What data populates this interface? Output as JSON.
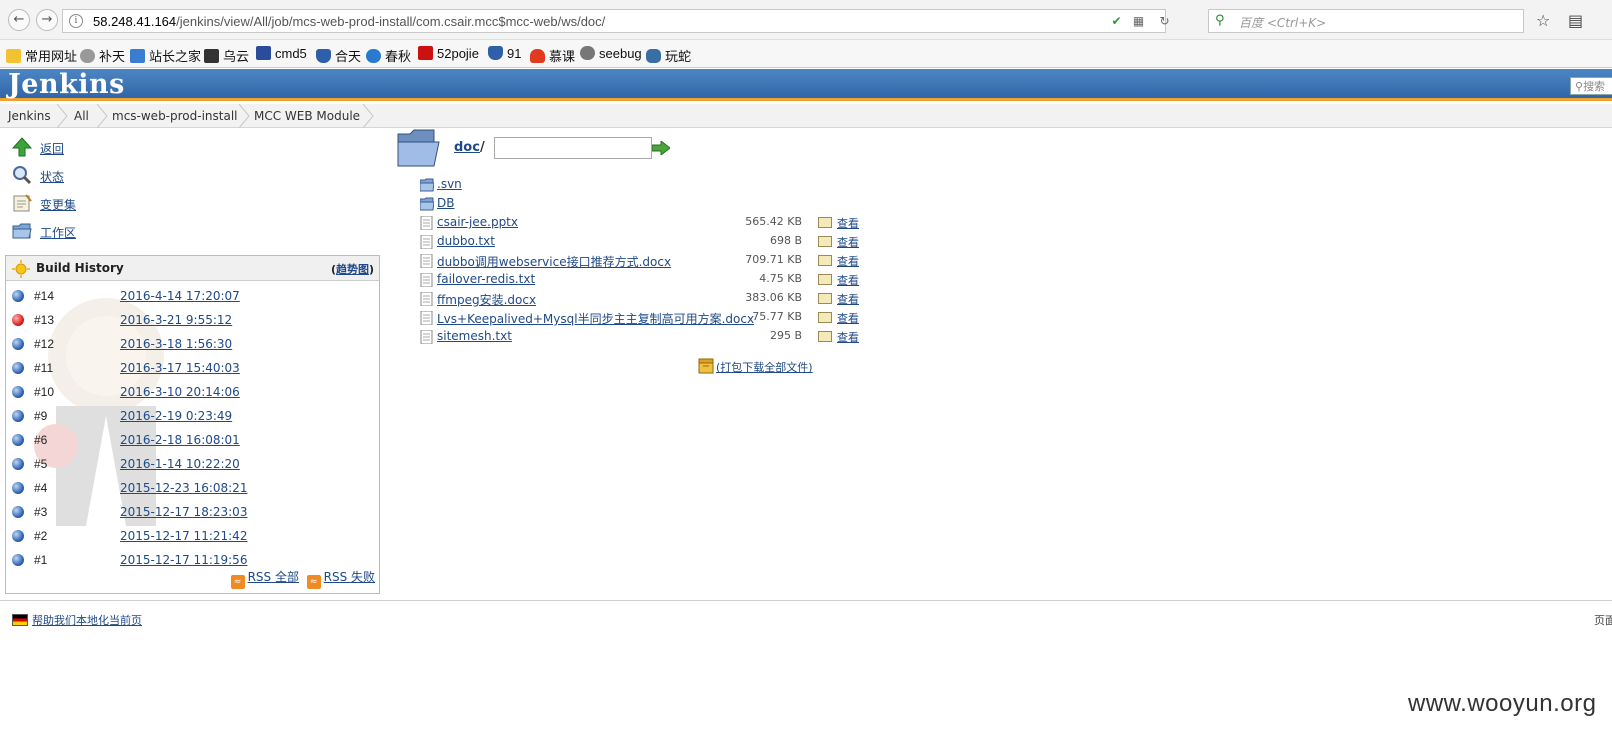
{
  "browser": {
    "url_host": "58.248.41.164",
    "url_path": "/jenkins/view/All/job/mcs-web-prod-install/com.csair.mcc$mcc-web/ws/doc/",
    "search_placeholder": "百度 <Ctrl+K>",
    "bookmarks": [
      {
        "label": "常用网址",
        "color": "#f2c230"
      },
      {
        "label": "补天",
        "color": "#888888"
      },
      {
        "label": "站长之家",
        "color": "#3a7cd0"
      },
      {
        "label": "乌云",
        "color": "#333333"
      },
      {
        "label": "cmd5",
        "color": "#2a4c9a"
      },
      {
        "label": "合天",
        "color": "#2f5fa8"
      },
      {
        "label": "春秋",
        "color": "#2a7ad0"
      },
      {
        "label": "52pojie",
        "color": "#cc1111"
      },
      {
        "label": "91",
        "color": "#2f5fa8"
      },
      {
        "label": "慕课",
        "color": "#e23a1e"
      },
      {
        "label": "seebug",
        "color": "#777777"
      },
      {
        "label": "玩蛇",
        "color": "#3a6ea5"
      }
    ]
  },
  "jenkins": {
    "logo": "Jenkins",
    "search_placeholder": "搜索",
    "breadcrumbs": [
      "Jenkins",
      "All",
      "mcs-web-prod-install",
      "MCC WEB Module"
    ]
  },
  "side_tasks": [
    {
      "label": "返回",
      "icon": "up-arrow-icon"
    },
    {
      "label": "状态",
      "icon": "magnifier-icon"
    },
    {
      "label": "变更集",
      "icon": "notepad-icon"
    },
    {
      "label": "工作区",
      "icon": "folder-icon"
    }
  ],
  "build_history": {
    "title": "Build History",
    "trend_label": "趋势图",
    "builds": [
      {
        "number": "#14",
        "date": "2016-4-14 17:20:07",
        "status": "blue"
      },
      {
        "number": "#13",
        "date": "2016-3-21 9:55:12",
        "status": "red"
      },
      {
        "number": "#12",
        "date": "2016-3-18 1:56:30",
        "status": "blue"
      },
      {
        "number": "#11",
        "date": "2016-3-17 15:40:03",
        "status": "blue"
      },
      {
        "number": "#10",
        "date": "2016-3-10 20:14:06",
        "status": "blue"
      },
      {
        "number": "#9",
        "date": "2016-2-19 0:23:49",
        "status": "blue"
      },
      {
        "number": "#6",
        "date": "2016-2-18 16:08:01",
        "status": "blue"
      },
      {
        "number": "#5",
        "date": "2016-1-14 10:22:20",
        "status": "blue"
      },
      {
        "number": "#4",
        "date": "2015-12-23 16:08:21",
        "status": "blue"
      },
      {
        "number": "#3",
        "date": "2015-12-17 18:23:03",
        "status": "blue"
      },
      {
        "number": "#2",
        "date": "2015-12-17 11:21:42",
        "status": "blue"
      },
      {
        "number": "#1",
        "date": "2015-12-17 11:19:56",
        "status": "blue"
      }
    ],
    "rss_all": "RSS 全部",
    "rss_failed": "RSS 失败"
  },
  "workspace": {
    "dir_link": "doc",
    "dir_sep": "/",
    "path_input_value": "",
    "entries": [
      {
        "name": ".svn",
        "type": "folder",
        "size": "",
        "view": ""
      },
      {
        "name": "DB",
        "type": "folder",
        "size": "",
        "view": ""
      },
      {
        "name": "csair-jee.pptx",
        "type": "file",
        "size": "565.42 KB",
        "view": "查看"
      },
      {
        "name": "dubbo.txt",
        "type": "file",
        "size": "698 B",
        "view": "查看"
      },
      {
        "name": "dubbo调用webservice接口推荐方式.docx",
        "type": "file",
        "size": "709.71 KB",
        "view": "查看"
      },
      {
        "name": "failover-redis.txt",
        "type": "file",
        "size": "4.75 KB",
        "view": "查看"
      },
      {
        "name": "ffmpeg安装.docx",
        "type": "file",
        "size": "383.06 KB",
        "view": "查看"
      },
      {
        "name": "Lvs+Keepalived+Mysql半同步主主复制高可用方案.docx",
        "type": "file",
        "size": "75.77 KB",
        "view": "查看"
      },
      {
        "name": "sitemesh.txt",
        "type": "file",
        "size": "295 B",
        "view": "查看"
      }
    ],
    "zip_link": "(打包下载全部文件)"
  },
  "footer": {
    "help_link": "帮助我们本地化当前页",
    "right_text": "页面",
    "watermark": "www.wooyun.org"
  }
}
